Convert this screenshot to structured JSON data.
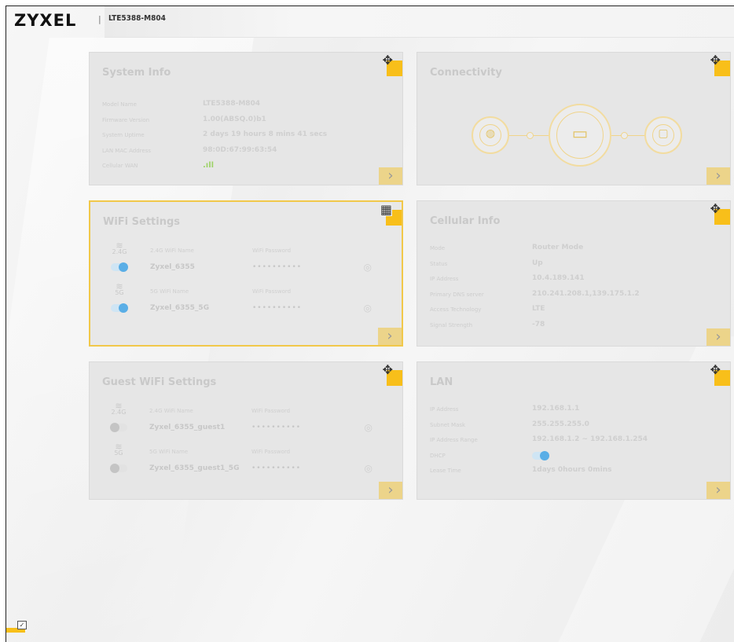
{
  "header": {
    "logo": "ZYXEL",
    "separator": "|",
    "model": "LTE5388-M804"
  },
  "cards": {
    "system_info": {
      "title": "System Info",
      "rows": [
        {
          "label": "Model Name",
          "value": "LTE5388-M804"
        },
        {
          "label": "Firmware Version",
          "value": "1.00(ABSQ.0)b1"
        },
        {
          "label": "System Uptime",
          "value": "2 days 19 hours 8 mins 41 secs"
        },
        {
          "label": "LAN MAC Address",
          "value": "98:0D:67:99:63:54"
        },
        {
          "label": "Cellular WAN",
          "value": "signal-bars"
        }
      ]
    },
    "connectivity": {
      "title": "Connectivity",
      "nodes": [
        "globe-icon",
        "router-icon",
        "laptop-icon"
      ]
    },
    "wifi_settings": {
      "title": "WiFi Settings",
      "bands": [
        {
          "band": "2.4G",
          "name_label": "2.4G WiFi Name",
          "name": "Zyxel_6355",
          "pw_label": "WiFi Password",
          "password": "••••••••••",
          "enabled": true
        },
        {
          "band": "5G",
          "name_label": "5G WiFi Name",
          "name": "Zyxel_6355_5G",
          "pw_label": "WiFi Password",
          "password": "••••••••••",
          "enabled": true
        }
      ]
    },
    "cellular_info": {
      "title": "Cellular Info",
      "rows": [
        {
          "label": "Mode",
          "value": "Router Mode"
        },
        {
          "label": "Status",
          "value": "Up"
        },
        {
          "label": "IP Address",
          "value": "10.4.189.141"
        },
        {
          "label": "Primary DNS server",
          "value": "210.241.208.1,139.175.1.2"
        },
        {
          "label": "Access Technology",
          "value": "LTE"
        },
        {
          "label": "Signal Strength",
          "value": "-78"
        }
      ]
    },
    "guest_wifi": {
      "title": "Guest WiFi Settings",
      "bands": [
        {
          "band": "2.4G",
          "name_label": "2.4G WiFi Name",
          "name": "Zyxel_6355_guest1",
          "pw_label": "WiFi Password",
          "password": "••••••••••",
          "enabled": false
        },
        {
          "band": "5G",
          "name_label": "5G WiFi Name",
          "name": "Zyxel_6355_guest1_5G",
          "pw_label": "WiFi Password",
          "password": "••••••••••",
          "enabled": false
        }
      ]
    },
    "lan": {
      "title": "LAN",
      "rows": [
        {
          "label": "IP Address",
          "value": "192.168.1.1"
        },
        {
          "label": "Subnet Mask",
          "value": "255.255.255.0"
        },
        {
          "label": "IP Address Range",
          "value": "192.168.1.2 ~ 192.168.1.254"
        },
        {
          "label": "DHCP",
          "value": ""
        },
        {
          "label": "Lease Time",
          "value": "1days 0hours 0mins"
        }
      ]
    }
  },
  "icons": {
    "move": "move-arrows-icon",
    "more": "chevron-right-icon",
    "eye": "eye-icon",
    "wifi": "wifi-icon"
  },
  "colors": {
    "accent": "#f8bf1a",
    "toggle_on": "#5aaee6",
    "card_bg": "#e6e6e6"
  }
}
